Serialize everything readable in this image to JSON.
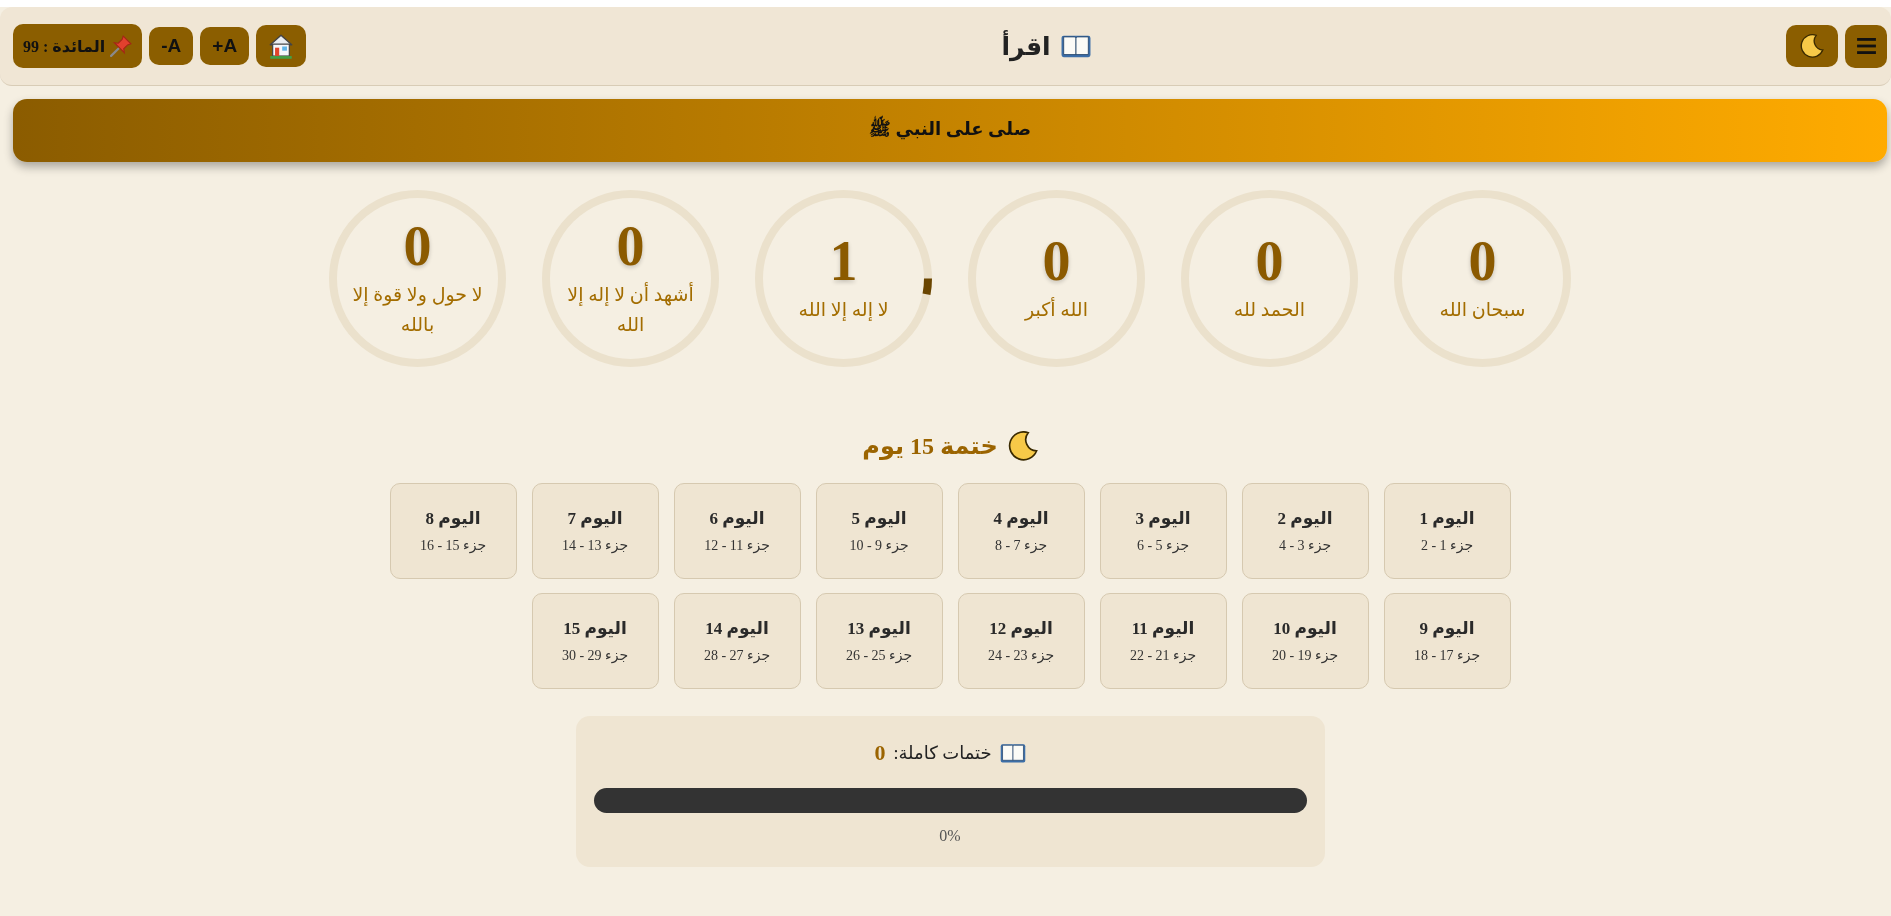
{
  "header": {
    "side_buttons": [
      {
        "kind": "menu"
      },
      {
        "kind": "theme"
      }
    ],
    "title": "اقرأ",
    "controls": [
      {
        "kind": "home"
      },
      {
        "kind": "text",
        "label": "A+"
      },
      {
        "kind": "text",
        "label": "A-"
      },
      {
        "kind": "pin",
        "label": "المائدة : 99"
      }
    ]
  },
  "banner": {
    "text": "صلى على النبي ﷺ"
  },
  "counters": [
    {
      "count": "0",
      "label": "سبحان الله"
    },
    {
      "count": "0",
      "label": "الحمد لله"
    },
    {
      "count": "0",
      "label": "الله أكبر"
    },
    {
      "count": "1",
      "label": "لا إله إلا الله",
      "level": 0.03
    },
    {
      "count": "0",
      "label": "أشهد أن لا إله إلا الله"
    },
    {
      "count": "0",
      "label": "لا حول ولا قوة إلا بالله"
    }
  ],
  "plan": {
    "title": "ختمة 15 يوم",
    "days": [
      {
        "label": "اليوم 1",
        "range": "جزء 1 - 2"
      },
      {
        "label": "اليوم 2",
        "range": "جزء 3 - 4"
      },
      {
        "label": "اليوم 3",
        "range": "جزء 5 - 6"
      },
      {
        "label": "اليوم 4",
        "range": "جزء 7 - 8"
      },
      {
        "label": "اليوم 5",
        "range": "جزء 9 - 10"
      },
      {
        "label": "اليوم 6",
        "range": "جزء 11 - 12"
      },
      {
        "label": "اليوم 7",
        "range": "جزء 13 - 14"
      },
      {
        "label": "اليوم 8",
        "range": "جزء 15 - 16"
      },
      {
        "label": "اليوم 9",
        "range": "جزء 17 - 18"
      },
      {
        "label": "اليوم 10",
        "range": "جزء 19 - 20"
      },
      {
        "label": "اليوم 11",
        "range": "جزء 21 - 22"
      },
      {
        "label": "اليوم 12",
        "range": "جزء 23 - 24"
      },
      {
        "label": "اليوم 13",
        "range": "جزء 25 - 26"
      },
      {
        "label": "اليوم 14",
        "range": "جزء 27 - 28"
      },
      {
        "label": "اليوم 15",
        "range": "جزء 29 - 30"
      }
    ]
  },
  "progress": {
    "label": "ختمات كاملة:",
    "count": "0",
    "reading": "0%"
  }
}
